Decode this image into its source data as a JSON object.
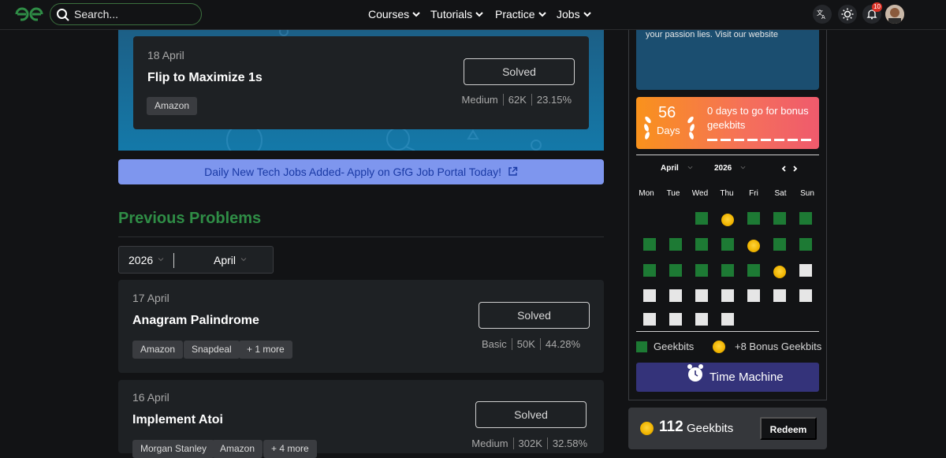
{
  "nav": {
    "search_placeholder": "Search...",
    "menus": [
      "Courses",
      "Tutorials",
      "Practice",
      "Jobs"
    ],
    "notifications_count": "10"
  },
  "potd": {
    "date": "18 April",
    "title": "Flip to Maximize 1s",
    "tags": [
      "Amazon"
    ],
    "status": "Solved",
    "difficulty": "Medium",
    "submissions": "62K",
    "accuracy": "23.15%"
  },
  "jobs_banner": "Daily New Tech Jobs Added- Apply on GfG Job Portal Today!",
  "previous": {
    "title": "Previous Problems",
    "year": "2026",
    "month": "April",
    "problems": [
      {
        "date": "17 April",
        "title": "Anagram Palindrome",
        "tags": [
          "Amazon",
          "Snapdeal",
          "+ 1 more"
        ],
        "status": "Solved",
        "difficulty": "Basic",
        "submissions": "50K",
        "accuracy": "44.28%"
      },
      {
        "date": "16 April",
        "title": "Implement Atoi",
        "tags": [
          "Morgan Stanley",
          "Amazon",
          "+ 4 more"
        ],
        "status": "Solved",
        "difficulty": "Medium",
        "submissions": "302K",
        "accuracy": "32.58%"
      }
    ]
  },
  "sidebar": {
    "promo_text": "your passion lies. Visit our website",
    "streak_number": "56",
    "streak_unit": "Days",
    "streak_message": "0 days to go for bonus geekbits",
    "calendar": {
      "month": "April",
      "year": "2026",
      "weekdays": [
        "Mon",
        "Tue",
        "Wed",
        "Thu",
        "Fri",
        "Sat",
        "Sun"
      ]
    },
    "legend_geekbits": "Geekbits",
    "legend_bonus": "+8 Bonus Geekbits",
    "time_machine": "Time Machine",
    "geekbits_count": "112",
    "geekbits_label": "Geekbits",
    "redeem": "Redeem"
  },
  "colors": {
    "brand_green": "#2f8d46",
    "bg": "#121315",
    "card": "#1e2124",
    "jobs_banner": "#7e96ee"
  }
}
